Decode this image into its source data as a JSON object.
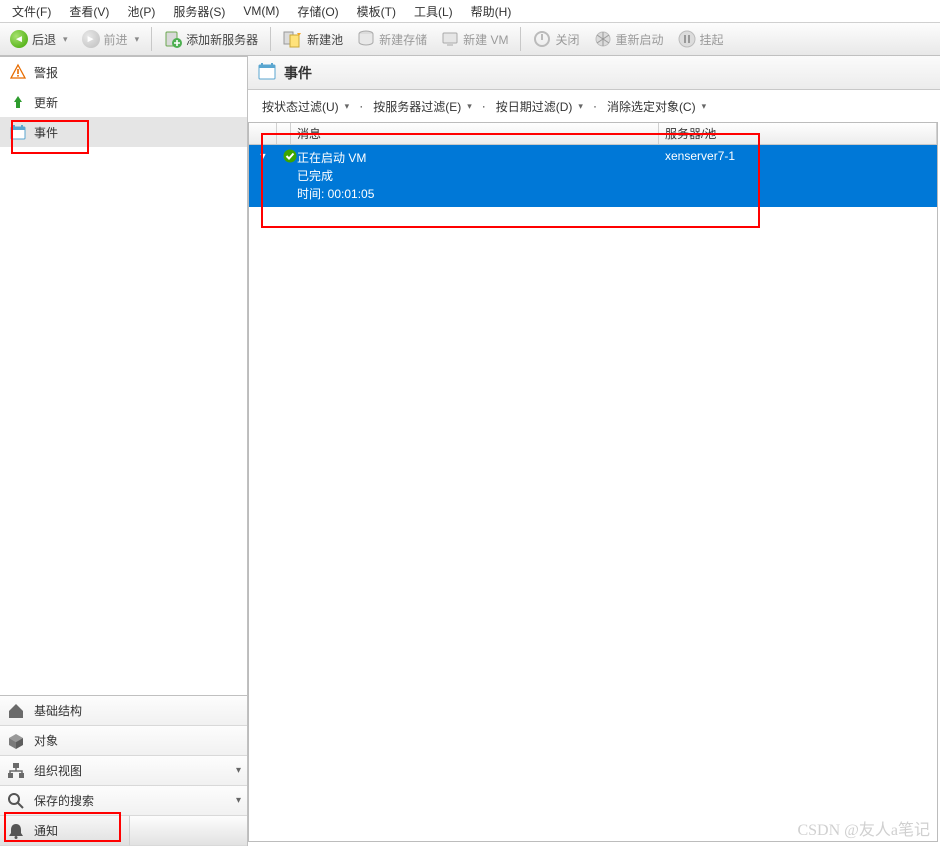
{
  "menu": {
    "file": "文件(F)",
    "view": "查看(V)",
    "pool": "池(P)",
    "server": "服务器(S)",
    "vm": "VM(M)",
    "storage": "存储(O)",
    "template": "模板(T)",
    "tools": "工具(L)",
    "help": "帮助(H)"
  },
  "toolbar": {
    "back": "后退",
    "forward": "前进",
    "add_server": "添加新服务器",
    "new_pool": "新建池",
    "new_storage": "新建存储",
    "new_vm": "新建 VM",
    "shutdown": "关闭",
    "restart": "重新启动",
    "suspend": "挂起"
  },
  "left_nav": {
    "alerts": "警报",
    "updates": "更新",
    "events": "事件"
  },
  "left_bottom": {
    "infra": "基础结构",
    "objects": "对象",
    "orgview": "组织视图",
    "saved_search": "保存的搜索",
    "notifications": "通知"
  },
  "right": {
    "title": "事件",
    "filters": {
      "status": "按状态过滤(U)",
      "server": "按服务器过滤(E)",
      "date": "按日期过滤(D)",
      "dismiss": "消除选定对象(C)"
    },
    "columns": {
      "msg": "消息",
      "server": "服务器/池"
    },
    "row": {
      "line1": "正在启动 VM",
      "line2": "已完成",
      "line3": "时间: 00:01:05",
      "server": "xenserver7-1"
    }
  },
  "watermark": "CSDN @友人a笔记"
}
